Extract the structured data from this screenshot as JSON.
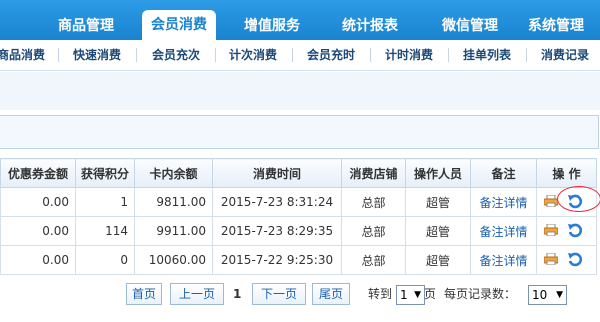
{
  "top_tabs": [
    "商品管理",
    "会员消费",
    "增值服务",
    "统计报表",
    "微信管理",
    "系统管理"
  ],
  "sub_tabs": [
    "商品消费",
    "快速消费",
    "会员充次",
    "计次消费",
    "会员充时",
    "计时消费",
    "挂单列表",
    "消费记录"
  ],
  "table": {
    "headers": [
      "优惠券金额",
      "获得积分",
      "卡内余额",
      "消费时间",
      "消费店铺",
      "操作人员",
      "备注",
      "操 作"
    ],
    "rows": [
      {
        "coupon": "0.00",
        "points": "1",
        "balance": "9811.00",
        "time": "2015-7-23 8:31:24",
        "store": "总部",
        "operator": "超管",
        "note": "备注详情"
      },
      {
        "coupon": "0.00",
        "points": "114",
        "balance": "9911.00",
        "time": "2015-7-23 8:29:35",
        "store": "总部",
        "operator": "超管",
        "note": "备注详情"
      },
      {
        "coupon": "0.00",
        "points": "0",
        "balance": "10060.00",
        "time": "2015-7-22 9:25:30",
        "store": "总部",
        "operator": "超管",
        "note": "备注详情"
      }
    ]
  },
  "pagination": {
    "first": "首页",
    "prev": "上一页",
    "current": "1",
    "next": "下一页",
    "last": "尾页",
    "goto_label": "转到",
    "goto_value": "1",
    "page_unit": "页",
    "per_page_label": "每页记录数：",
    "per_page_value": "10"
  },
  "icons": {
    "print": "printer-icon",
    "undo": "refresh-icon"
  },
  "colors": {
    "nav": "#1a83cf",
    "link": "#1a5fae",
    "highlight": "#e22233"
  }
}
